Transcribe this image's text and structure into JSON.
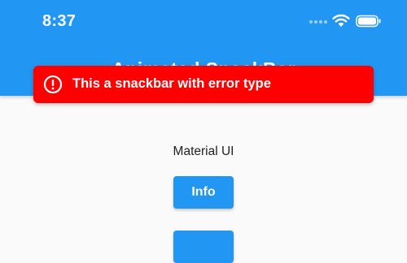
{
  "status_bar": {
    "time": "8:37"
  },
  "app_bar": {
    "title": "Animated SnackBar",
    "color": "#2196f3"
  },
  "snackbar": {
    "message": "This a snackbar with error type",
    "icon": "error-icon",
    "color": "#ff0000"
  },
  "content": {
    "label": "Material UI",
    "buttons": [
      {
        "label": "Info"
      },
      {
        "label": ""
      }
    ]
  }
}
